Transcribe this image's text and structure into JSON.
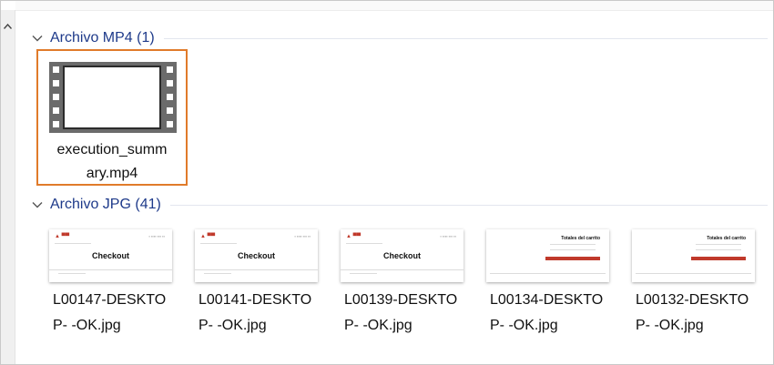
{
  "groups": {
    "mp4": {
      "title": "Archivo MP4 (1)",
      "items": [
        {
          "name_line1": "execution_summ",
          "name_line2": "ary.mp4"
        }
      ]
    },
    "jpg": {
      "title": "Archivo JPG (41)",
      "items": [
        {
          "name_line1": "L00147-DESKTO",
          "name_line2": "P-  -OK.jpg",
          "preview_heading": "Checkout"
        },
        {
          "name_line1": "L00141-DESKTO",
          "name_line2": "P-  -OK.jpg",
          "preview_heading": "Checkout"
        },
        {
          "name_line1": "L00139-DESKTO",
          "name_line2": "P-  -OK.jpg",
          "preview_heading": "Checkout"
        },
        {
          "name_line1": "L00134-DESKTO",
          "name_line2": "P-  -OK.jpg",
          "preview_heading": "Totales del carrito"
        },
        {
          "name_line1": "L00132-DESKTO",
          "name_line2": "P-  -OK.jpg",
          "preview_heading": "Totales del carrito"
        }
      ]
    }
  },
  "colors": {
    "group_title": "#1e3a8a",
    "selection_border": "#e07b2a",
    "brand_red": "#c0392b"
  },
  "icons": {
    "scroll_up": "chevron-up-icon",
    "group_toggle": "chevron-down-icon",
    "video": "film-strip-icon"
  }
}
